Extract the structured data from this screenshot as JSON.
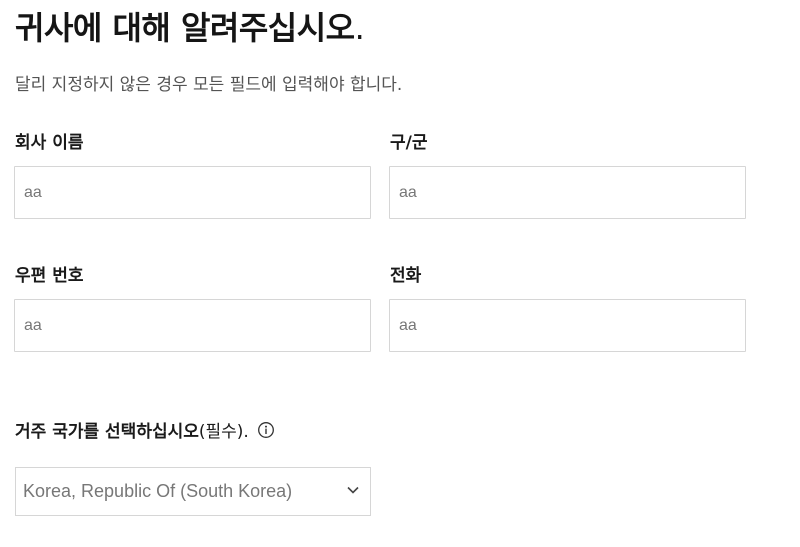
{
  "header": {
    "title": "귀사에 대해 알려주십시오",
    "title_period": ".",
    "subtitle": "달리 지정하지 않은 경우 모든 필드에 입력해야 합니다."
  },
  "fields": {
    "company_name": {
      "label": "회사 이름",
      "value": "aa"
    },
    "district": {
      "label": "구/군",
      "value": "aa"
    },
    "postal_code": {
      "label": "우편 번호",
      "value": "aa"
    },
    "phone": {
      "label": "전화",
      "value": "aa"
    }
  },
  "country": {
    "label_main": "거주 국가를 선택하십시오",
    "label_required": "(필수).",
    "info_icon": "info-icon",
    "selected": "Korea, Republic Of (South Korea)",
    "dropdown_icon": "chevron-down-icon"
  }
}
